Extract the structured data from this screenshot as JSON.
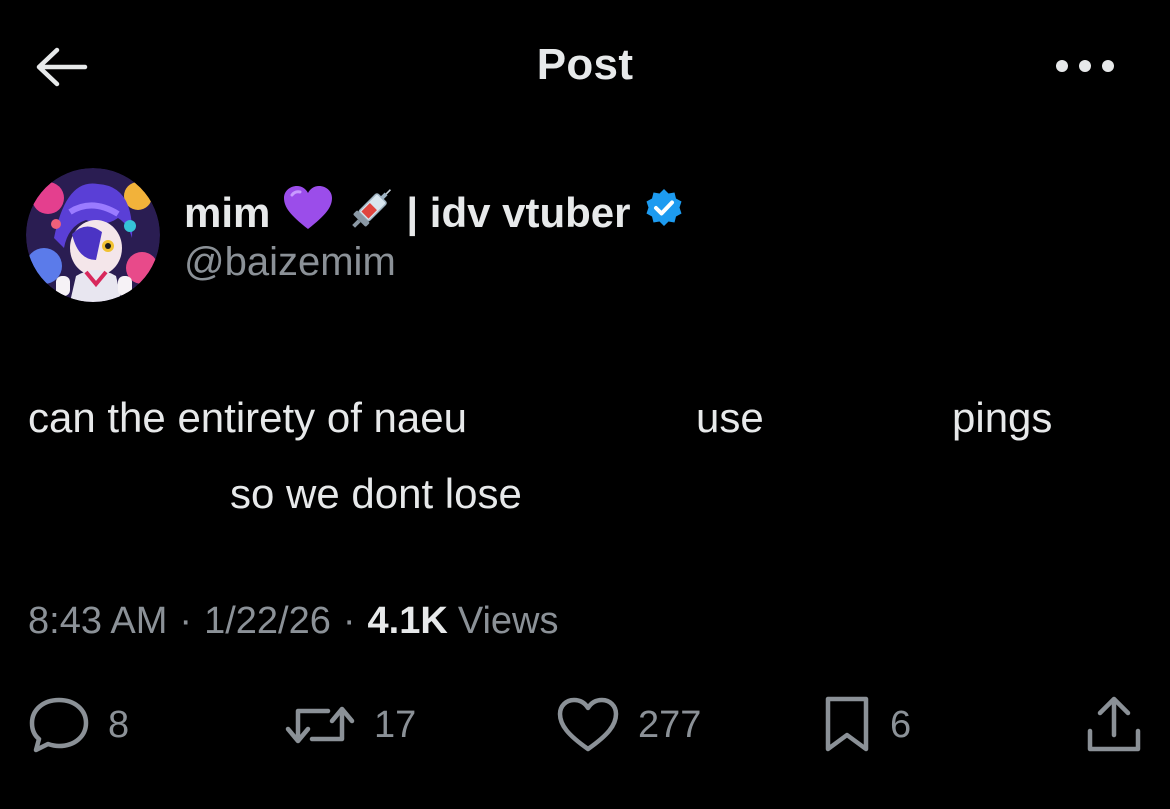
{
  "header": {
    "title": "Post"
  },
  "author": {
    "display_name": "mim",
    "name_suffix": "| idv vtuber",
    "emojis": [
      "purple-heart",
      "syringe"
    ],
    "handle": "@baizemim",
    "verified": true
  },
  "post": {
    "lines": [
      [
        "can the entirety of naeu",
        "use",
        "pings"
      ],
      [
        "so we dont lose"
      ]
    ]
  },
  "meta": {
    "time": "8:43 AM",
    "separator": "·",
    "date": "1/22/26",
    "views_count": "4.1K",
    "views_label": "Views"
  },
  "actions": {
    "replies": "8",
    "reposts": "17",
    "likes": "277",
    "bookmarks": "6"
  },
  "colors": {
    "background": "#000000",
    "text": "#e7e9ea",
    "secondary": "#8b9197",
    "verified": "#1d9bf0",
    "heart_emoji": "#9b4dea"
  }
}
